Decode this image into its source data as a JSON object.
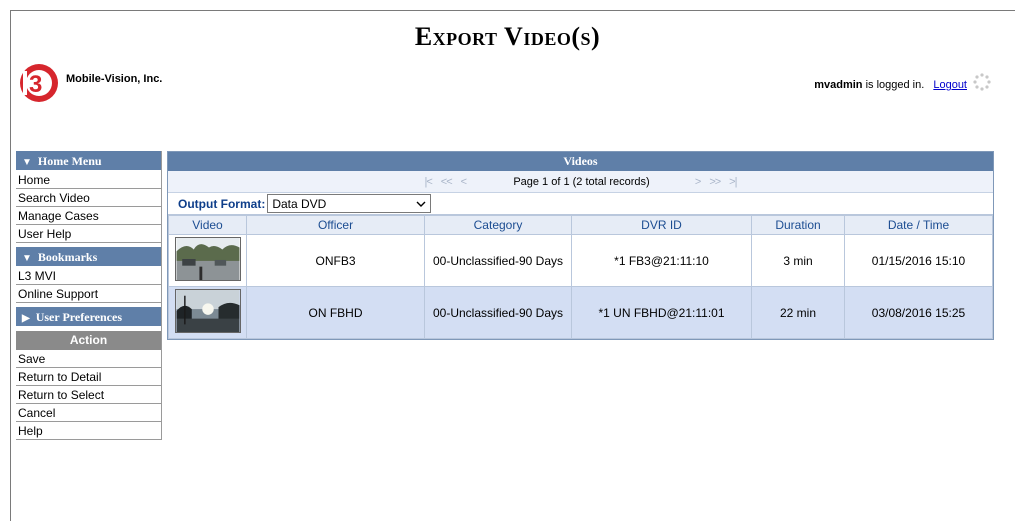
{
  "page": {
    "title": "Export Video(s)"
  },
  "header": {
    "company": "Mobile-Vision, Inc.",
    "user": "mvadmin",
    "logged_in_text": "is logged in.",
    "logout_label": "Logout"
  },
  "sidebar": {
    "home_menu": {
      "title": "Home Menu",
      "items": [
        "Home",
        "Search Video",
        "Manage Cases",
        "User Help"
      ]
    },
    "bookmarks": {
      "title": "Bookmarks",
      "items": [
        "L3 MVI",
        "Online Support"
      ]
    },
    "user_prefs": {
      "title": "User Preferences"
    },
    "action": {
      "title": "Action",
      "items": [
        "Save",
        "Return to Detail",
        "Return to Select",
        "Cancel",
        "Help"
      ]
    }
  },
  "videos": {
    "title": "Videos",
    "pager": {
      "first": "|<",
      "prev_fast": "<<",
      "prev": "<",
      "next": ">",
      "next_fast": ">>",
      "last": ">|",
      "info": "Page 1 of 1 (2 total records)"
    },
    "output_format": {
      "label": "Output Format:",
      "value": "Data DVD"
    },
    "columns": [
      "Video",
      "Officer",
      "Category",
      "DVR ID",
      "Duration",
      "Date / Time"
    ],
    "rows": [
      {
        "officer": "ONFB3",
        "category": "00-Unclassified-90 Days",
        "dvr_id": "*1 FB3@21:11:10",
        "duration": "3 min",
        "datetime": "01/15/2016 15:10"
      },
      {
        "officer": "ON FBHD",
        "category": "00-Unclassified-90 Days",
        "dvr_id": "*1 UN FBHD@21:11:01",
        "duration": "22 min",
        "datetime": "03/08/2016 15:25"
      }
    ]
  },
  "colors": {
    "header_blue": "#5f7fa8",
    "selected_row": "#d3def3",
    "link": "#0000cc"
  },
  "icons": [
    "l3-logo",
    "loading-spinner-icon",
    "chevron-down-icon",
    "triangle-down-icon",
    "triangle-right-icon"
  ]
}
